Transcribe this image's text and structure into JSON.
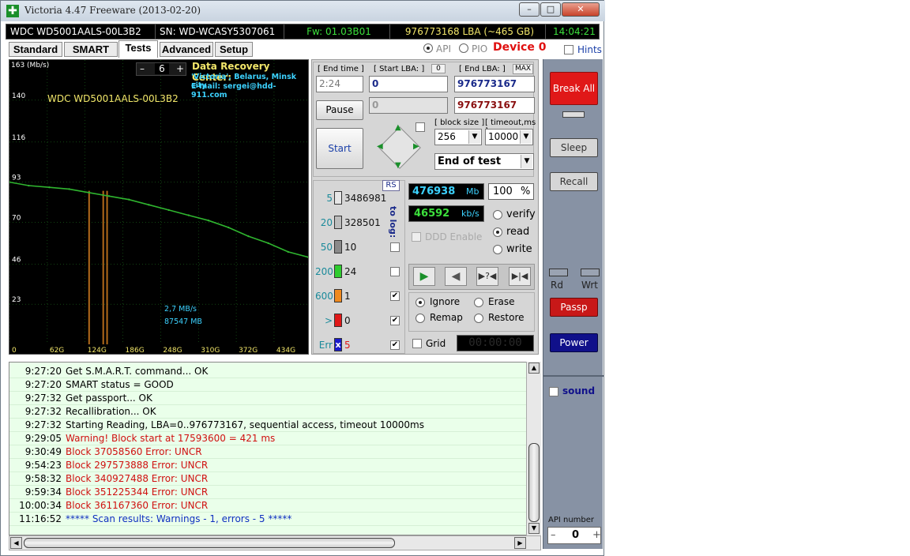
{
  "window": {
    "title": "Victoria 4.47  Freeware (2013-02-20)",
    "minimize": "–",
    "maximize": "□",
    "close": "✕"
  },
  "infobar": {
    "model": "WDC WD5001AALS-00L3B2",
    "serial": "SN: WD-WCASY5307061",
    "firmware": "Fw: 01.03B01",
    "lba": "976773168 LBA (~465 GB)",
    "clock": "14:04:21"
  },
  "tabs": [
    "Standard",
    "SMART",
    "Tests",
    "Advanced",
    "Setup"
  ],
  "mode": {
    "api": "API",
    "pio": "PIO",
    "device": "Device 0",
    "hints": "Hints"
  },
  "graph": {
    "unit": "163 (Mb/s)",
    "y_ticks": [
      "140",
      "116",
      "93",
      "70",
      "46",
      "23"
    ],
    "x_ticks": [
      "0",
      "62G",
      "124G",
      "186G",
      "248G",
      "310G",
      "372G",
      "434G"
    ],
    "counter": "6",
    "minus": "–",
    "plus": "+",
    "drive": "WDC WD5001AALS-00L3B2",
    "center_title": "Data Recovery Center:",
    "center_line1": "'Victoria', Belarus, Minsk city",
    "center_line2": "E-mail: sergei@hdd-911.com",
    "speed_now": "2,7 MB/s",
    "pos_now": "87547 MB",
    "colors": {
      "line": "#2fb52f",
      "grid": "#1c6b1c",
      "spike": "#b36a1a"
    }
  },
  "chart_data": {
    "type": "line",
    "x": [
      0,
      30,
      62,
      93,
      124,
      155,
      186,
      217,
      248,
      279,
      310,
      341,
      372,
      403,
      434,
      465
    ],
    "values": [
      93,
      91,
      90,
      89,
      87,
      85,
      83,
      80,
      77,
      74,
      71,
      67,
      62,
      58,
      53,
      50
    ],
    "spikes_x": [
      124,
      146,
      152
    ],
    "ylim": [
      0,
      163
    ],
    "xlim": [
      0,
      465
    ],
    "ylabel": "(Mb/s)"
  },
  "ctrl": {
    "end_time_label": "[ End time ]",
    "end_time": "2:24",
    "start_lba_label": "[ Start LBA: ]",
    "start_lba_badge": "0",
    "start_lba": "0",
    "start_lba2": "0",
    "end_lba_label": "[ End LBA: ]",
    "end_lba_max": "MAX",
    "end_lba": "976773167",
    "end_lba2": "976773167",
    "pause": "Pause",
    "start": "Start",
    "block_size_label": "[ block size ]",
    "block_size": "256",
    "timeout_label": "[ timeout,ms ]",
    "timeout": "10000",
    "end_mode": "End of test",
    "rs": "RS",
    "to_log": "to log:",
    "legend": [
      {
        "ms": "5",
        "count": "3486981",
        "color": "#e6e6e6",
        "checked": ""
      },
      {
        "ms": "20",
        "count": "328501",
        "color": "#bdbdbd",
        "checked": ""
      },
      {
        "ms": "50",
        "count": "10",
        "color": "#8a8a8a",
        "checked": ""
      },
      {
        "ms": "200",
        "count": "24",
        "color": "#2ecc2e",
        "checked": ""
      },
      {
        "ms": "600",
        "count": "1",
        "color": "#f08a1e",
        "checked": "✔"
      },
      {
        "ms": ">",
        "count": "0",
        "color": "#e01818",
        "checked": "✔"
      },
      {
        "ms": "Err",
        "count": "5",
        "color": "#1a1acc",
        "checked": "✔"
      }
    ],
    "err_mark": "x",
    "mb_value": "476938",
    "mb_unit": "Mb",
    "percent": "100",
    "percent_unit": "%",
    "speed_value": "46592",
    "speed_unit": "kb/s",
    "ddd": "DDD Enable",
    "verify": "verify",
    "read": "read",
    "write": "write",
    "play": "▶",
    "back": "◀",
    "skip": "▶?◀",
    "end": "▶|◀",
    "ignore": "Ignore",
    "erase": "Erase",
    "remap": "Remap",
    "restore": "Restore",
    "grid": "Grid",
    "grid_timer": "00:00:00"
  },
  "right": {
    "break_all": "Break All",
    "sleep": "Sleep",
    "recall": "Recall",
    "rd": "Rd",
    "wrt": "Wrt",
    "passp": "Passp",
    "power": "Power",
    "sound": "sound",
    "api_number_label": "API number",
    "api_number": "0",
    "api_minus": "–",
    "api_plus": "+"
  },
  "log": [
    {
      "time": "9:27:20",
      "msg": "Get S.M.A.R.T. command... OK",
      "color": "#000000"
    },
    {
      "time": "9:27:20",
      "msg": "SMART status = GOOD",
      "color": "#000000"
    },
    {
      "time": "9:27:32",
      "msg": "Get passport... OK",
      "color": "#000000"
    },
    {
      "time": "9:27:32",
      "msg": "Recallibration... OK",
      "color": "#000000"
    },
    {
      "time": "9:27:32",
      "msg": "Starting Reading, LBA=0..976773167, sequential access, timeout 10000ms",
      "color": "#000000"
    },
    {
      "time": "9:29:05",
      "msg": "Warning! Block start at 17593600 = 421 ms",
      "color": "#d01010"
    },
    {
      "time": "9:30:49",
      "msg": "Block 37058560 Error: UNCR",
      "color": "#d01010"
    },
    {
      "time": "9:54:23",
      "msg": "Block 297573888 Error: UNCR",
      "color": "#d01010"
    },
    {
      "time": "9:58:32",
      "msg": "Block 340927488 Error: UNCR",
      "color": "#d01010"
    },
    {
      "time": "9:59:34",
      "msg": "Block 351225344 Error: UNCR",
      "color": "#d01010"
    },
    {
      "time": "10:00:34",
      "msg": "Block 361167360 Error: UNCR",
      "color": "#d01010"
    },
    {
      "time": "11:16:52",
      "msg": "***** Scan results: Warnings - 1, errors - 5 *****",
      "color": "#1030c0"
    }
  ]
}
